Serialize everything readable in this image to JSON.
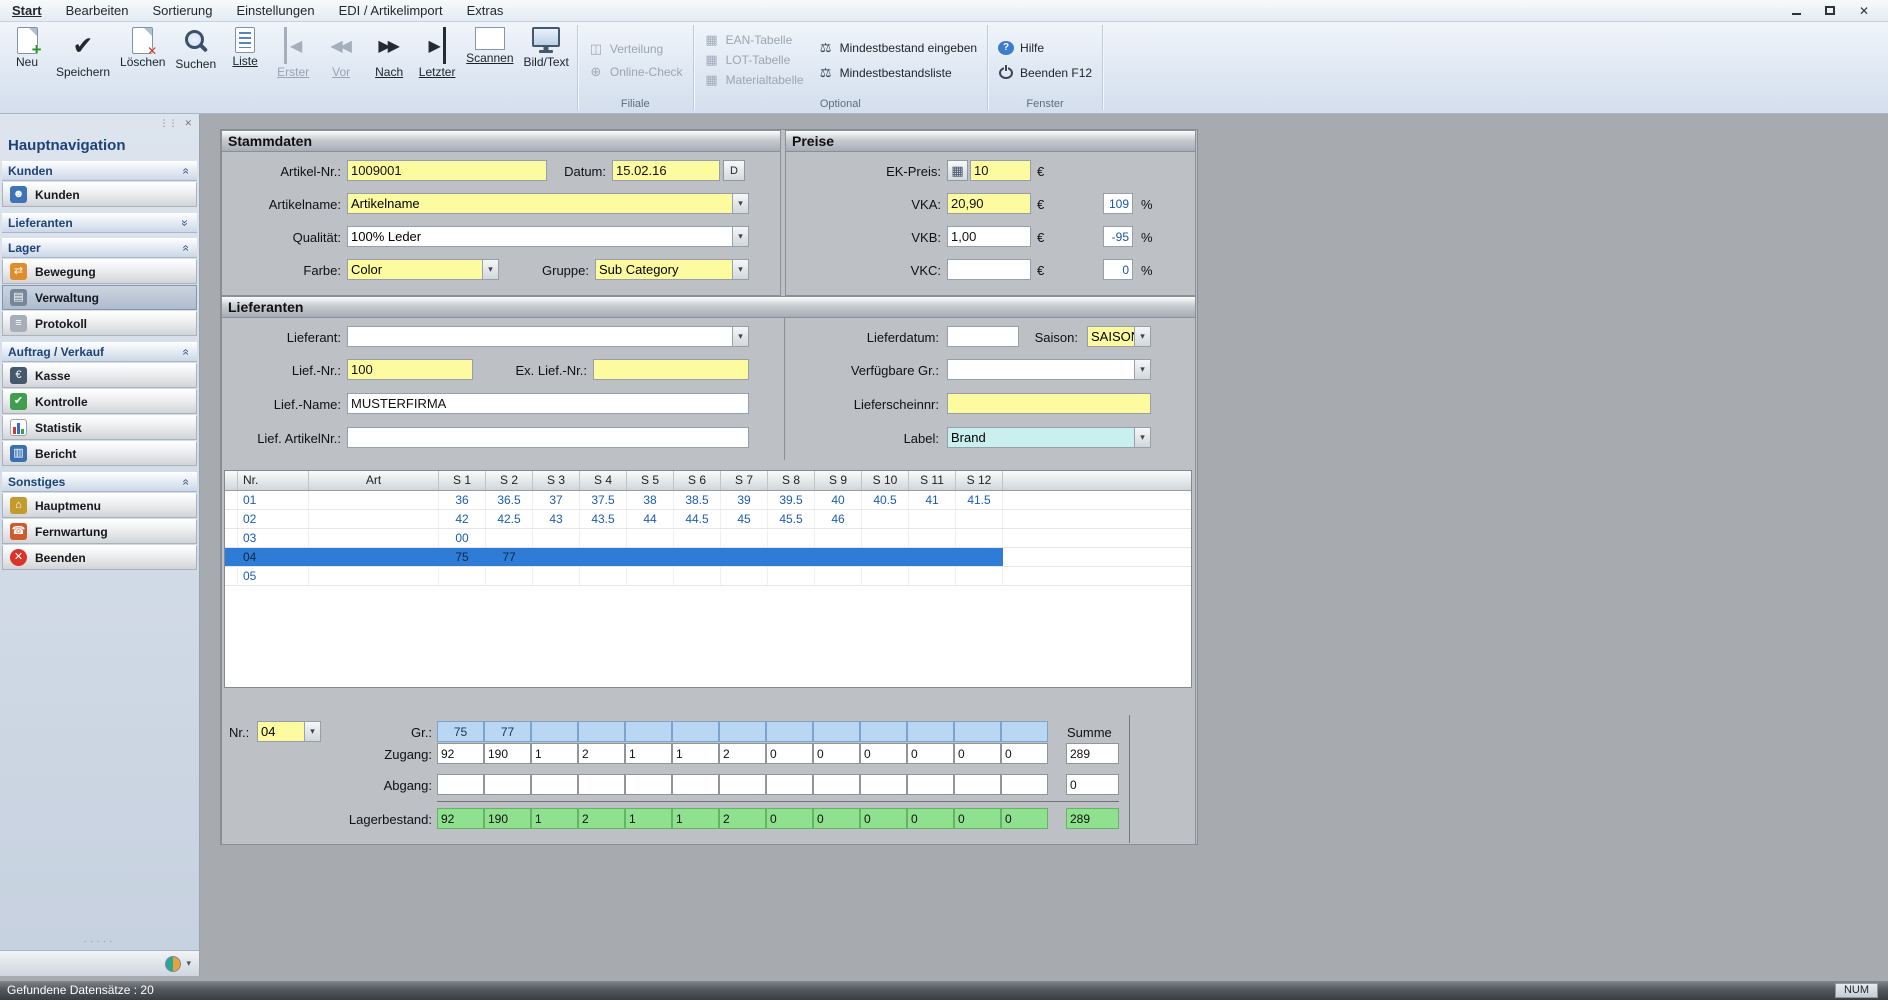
{
  "menu_bar": {
    "items": [
      "Start",
      "Bearbeiten",
      "Sortierung",
      "Einstellungen",
      "EDI / Artikelimport",
      "Extras"
    ]
  },
  "ribbon": {
    "main_buttons": [
      {
        "label": "Neu",
        "icon": "page-new",
        "enabled": true
      },
      {
        "label": "Speichern",
        "icon": "check",
        "glyph": "✔",
        "enabled": true
      },
      {
        "label": "Löschen",
        "icon": "page-delete",
        "enabled": true
      },
      {
        "label": "Suchen",
        "icon": "magnifier",
        "enabled": true
      },
      {
        "label": "Liste",
        "icon": "list",
        "enabled": true,
        "underline": true
      },
      {
        "label": "Erster",
        "icon": "first",
        "glyph": "◀",
        "enabled": false,
        "underline": true
      },
      {
        "label": "Vor",
        "icon": "prev",
        "glyph": "◀◀",
        "enabled": false,
        "underline": true
      },
      {
        "label": "Nach",
        "icon": "next",
        "glyph": "▶▶",
        "enabled": true,
        "underline": true
      },
      {
        "label": "Letzter",
        "icon": "last",
        "glyph": "▶",
        "enabled": true,
        "underline": true
      },
      {
        "label": "Scannen",
        "icon": "barcode",
        "enabled": true,
        "underline": true
      },
      {
        "label": "Bild/Text",
        "icon": "monitor",
        "enabled": true
      }
    ],
    "groups": {
      "filiale": {
        "label": "Filiale",
        "items": [
          {
            "label": "Verteilung",
            "icon": "distribution",
            "glyph": "◫",
            "enabled": false
          },
          {
            "label": "Online-Check",
            "icon": "globe",
            "glyph": "⊕",
            "enabled": false
          }
        ]
      },
      "optional": {
        "label": "Optional",
        "tables": [
          {
            "label": "EAN-Tabelle",
            "icon": "table",
            "glyph": "▦",
            "enabled": false
          },
          {
            "label": "LOT-Tabelle",
            "icon": "table",
            "glyph": "▦",
            "enabled": false
          },
          {
            "label": "Materialtabelle",
            "icon": "table",
            "glyph": "▦",
            "enabled": false
          }
        ],
        "actions": [
          {
            "label": "Mindestbestand eingeben",
            "icon": "scale",
            "glyph": "⚖",
            "enabled": true
          },
          {
            "label": "Mindestbestandsliste",
            "icon": "scale",
            "glyph": "⚖",
            "enabled": true
          }
        ]
      },
      "fenster": {
        "label": "Fenster",
        "items": [
          {
            "label": "Hilfe",
            "icon": "help",
            "glyph": "?",
            "enabled": true
          },
          {
            "label": "Beenden F12",
            "icon": "power",
            "enabled": true
          }
        ]
      }
    }
  },
  "sidebar": {
    "title": "Hauptnavigation",
    "sections": [
      {
        "header": "Kunden",
        "collapsed": false,
        "items": [
          {
            "label": "Kunden",
            "icon": "person",
            "glyph": "☻",
            "color": "#3e74b5"
          }
        ]
      },
      {
        "header": "Lieferanten",
        "collapsed": true,
        "items": []
      },
      {
        "header": "Lager",
        "collapsed": false,
        "items": [
          {
            "label": "Bewegung",
            "icon": "movement",
            "glyph": "⇄",
            "color": "#de8c2c"
          },
          {
            "label": "Verwaltung",
            "icon": "drawer",
            "glyph": "▤",
            "color": "#77879a",
            "selected": true
          },
          {
            "label": "Protokoll",
            "icon": "document",
            "glyph": "≡",
            "color": "#a5aeb9"
          }
        ]
      },
      {
        "header": "Auftrag / Verkauf",
        "collapsed": false,
        "items": [
          {
            "label": "Kasse",
            "icon": "cash-register",
            "glyph": "€",
            "color": "#46586c"
          },
          {
            "label": "Kontrolle",
            "icon": "control-check",
            "glyph": "✔",
            "color": "#3f9e4f"
          },
          {
            "label": "Statistik",
            "icon": "bar-chart",
            "glyph": ""
          },
          {
            "label": "Bericht",
            "icon": "report",
            "glyph": "▥",
            "color": "#3a6fb0"
          }
        ]
      },
      {
        "header": "Sonstiges",
        "collapsed": false,
        "items": [
          {
            "label": "Hauptmenu",
            "icon": "home",
            "glyph": "⌂",
            "color": "#c39a2e"
          },
          {
            "label": "Fernwartung",
            "icon": "phone",
            "glyph": "☎",
            "color": "#cf5a2c"
          },
          {
            "label": "Beenden",
            "icon": "power-quit",
            "glyph": "✕",
            "color": "#d8352a",
            "round": true
          }
        ]
      }
    ]
  },
  "stammdaten": {
    "title": "Stammdaten",
    "artikel_nr_label": "Artikel-Nr.:",
    "artikel_nr": "1009001",
    "datum_label": "Datum:",
    "datum": "15.02.16",
    "datum_button": "D",
    "artikelname_label": "Artikelname:",
    "artikelname": "Artikelname",
    "qualitaet_label": "Qualität:",
    "qualitaet": "100% Leder",
    "farbe_label": "Farbe:",
    "farbe": "Color",
    "gruppe_label": "Gruppe:",
    "gruppe": "Sub Category"
  },
  "preise": {
    "title": "Preise",
    "currency": "€",
    "percent": "%",
    "ek_label": "EK-Preis:",
    "ek": "10",
    "vka_label": "VKA:",
    "vka": "20,90",
    "vka_pct": "109",
    "vkb_label": "VKB:",
    "vkb": "1,00",
    "vkb_pct": "-95",
    "vkc_label": "VKC:",
    "vkc": "",
    "vkc_pct": "0"
  },
  "lieferanten": {
    "title": "Lieferanten",
    "lieferant_label": "Lieferant:",
    "lieferant": "",
    "lief_nr_label": "Lief.-Nr.:",
    "lief_nr": "100",
    "ex_lief_nr_label": "Ex. Lief.-Nr.:",
    "ex_lief_nr": "",
    "lief_name_label": "Lief.-Name:",
    "lief_name": "MUSTERFIRMA",
    "lief_artikelnr_label": "Lief. ArtikelNr.:",
    "lief_artikelnr": "",
    "lieferdatum_label": "Lieferdatum:",
    "lieferdatum": "",
    "saison_label": "Saison:",
    "saison": "SAISON",
    "verfuegbare_label": "Verfügbare Gr.:",
    "verfuegbare": "",
    "lieferschein_label": "Lieferscheinnr:",
    "lieferschein": "",
    "label_label": "Label:",
    "label_value": "Brand"
  },
  "size_grid": {
    "columns": [
      "Nr.",
      "Art",
      "S 1",
      "S 2",
      "S 3",
      "S 4",
      "S 5",
      "S 6",
      "S 7",
      "S 8",
      "S 9",
      "S 10",
      "S 11",
      "S 12"
    ],
    "rows": [
      {
        "nr": "01",
        "art": "",
        "selected": false,
        "sizes": [
          "36",
          "36.5",
          "37",
          "37.5",
          "38",
          "38.5",
          "39",
          "39.5",
          "40",
          "40.5",
          "41",
          "41.5"
        ]
      },
      {
        "nr": "02",
        "art": "",
        "selected": false,
        "sizes": [
          "42",
          "42.5",
          "43",
          "43.5",
          "44",
          "44.5",
          "45",
          "45.5",
          "46",
          "",
          "",
          ""
        ]
      },
      {
        "nr": "03",
        "art": "",
        "selected": false,
        "sizes": [
          "00",
          "",
          "",
          "",
          "",
          "",
          "",
          "",
          "",
          "",
          "",
          ""
        ]
      },
      {
        "nr": "04",
        "art": "",
        "selected": true,
        "sizes": [
          "75",
          "77",
          "",
          "",
          "",
          "",
          "",
          "",
          "",
          "",
          "",
          ""
        ]
      },
      {
        "nr": "05",
        "art": "",
        "selected": false,
        "sizes": [
          "",
          "",
          "",
          "",
          "",
          "",
          "",
          "",
          "",
          "",
          "",
          ""
        ]
      }
    ]
  },
  "bestand": {
    "nr_label": "Nr.:",
    "nr": "04",
    "gr_label": "Gr.:",
    "gr": [
      "75",
      "77",
      "",
      "",
      "",
      "",
      "",
      "",
      "",
      "",
      "",
      "",
      ""
    ],
    "zugang_label": "Zugang:",
    "zugang": [
      "92",
      "190",
      "1",
      "2",
      "1",
      "1",
      "2",
      "0",
      "0",
      "0",
      "0",
      "0",
      "0"
    ],
    "abgang_label": "Abgang:",
    "abgang": [
      "",
      "",
      "",
      "",
      "",
      "",
      "",
      "",
      "",
      "",
      "",
      "",
      ""
    ],
    "lager_label": "Lagerbestand:",
    "lager": [
      "92",
      "190",
      "1",
      "2",
      "1",
      "1",
      "2",
      "0",
      "0",
      "0",
      "0",
      "0",
      "0"
    ],
    "summe_label": "Summe",
    "zugang_summe": "289",
    "abgang_summe": "0",
    "lager_summe": "289"
  },
  "status_bar": {
    "left": "Gefundene Datensätze :  20",
    "right": "NUM"
  }
}
